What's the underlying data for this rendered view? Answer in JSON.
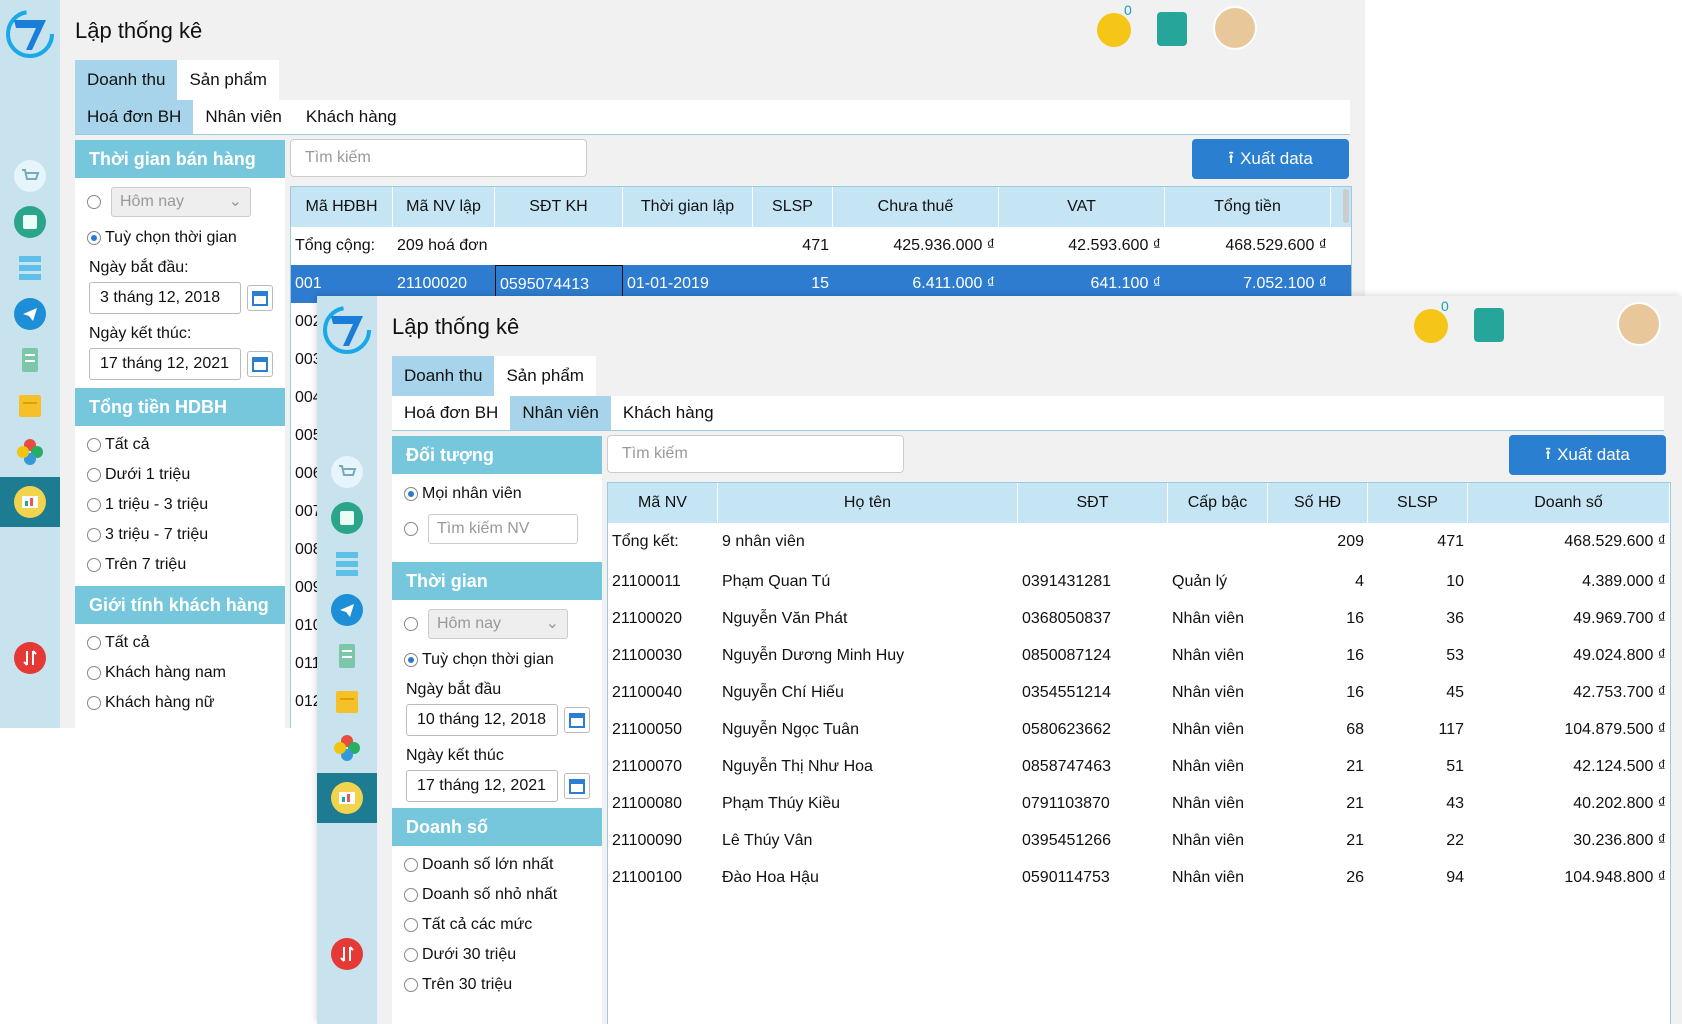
{
  "win1": {
    "title": "Lập thống kê",
    "badge_count": "0",
    "main_tabs": [
      "Doanh thu",
      "Sản phẩm"
    ],
    "sub_tabs": [
      "Hoá đơn BH",
      "Nhân viên",
      "Khách hàng"
    ],
    "sections": {
      "time": "Thời gian bán hàng",
      "total": "Tổng tiền HDBH",
      "gender": "Giới tính khách hàng"
    },
    "time_combo": "Hôm nay",
    "custom_time": "Tuỳ chọn thời gian",
    "start_label": "Ngày bắt đầu:",
    "start_value": "3 tháng 12, 2018",
    "end_label": "Ngày kết thúc:",
    "end_value": "17 tháng 12, 2021",
    "total_options": [
      "Tất cả",
      "Dưới 1 triệu",
      "1 triệu - 3 triệu",
      "3 triệu - 7 triệu",
      "Trên 7 triệu"
    ],
    "gender_options": [
      "Tất cả",
      "Khách hàng nam",
      "Khách hàng nữ"
    ],
    "search_placeholder": "Tìm kiếm",
    "export_label": "Xuất data",
    "columns": [
      "Mã HĐBH",
      "Mã NV lập",
      "SĐT KH",
      "Thời gian lập",
      "SLSP",
      "Chưa thuế",
      "VAT",
      "Tổng tiền"
    ],
    "summary": {
      "label": "Tổng cộng:",
      "count": "209 hoá đơn",
      "slsp": "471",
      "pretax": "425.936.000 ₫",
      "vat": "42.593.600 ₫",
      "total": "468.529.600 ₫"
    },
    "selected_row": {
      "id": "001",
      "staff": "21100020",
      "phone": "0595074413",
      "date": "01-01-2019",
      "slsp": "15",
      "pretax": "6.411.000 ₫",
      "vat": "641.100 ₫",
      "total": "7.052.100 ₫"
    },
    "row_ids": [
      "002",
      "003",
      "004",
      "005",
      "006",
      "007",
      "008",
      "009",
      "010",
      "011",
      "012"
    ]
  },
  "win2": {
    "title": "Lập thống kê",
    "badge_count": "0",
    "main_tabs": [
      "Doanh thu",
      "Sản phẩm"
    ],
    "sub_tabs": [
      "Hoá đơn BH",
      "Nhân viên",
      "Khách hàng"
    ],
    "sections": {
      "target": "Đối tượng",
      "time": "Thời gian",
      "revenue": "Doanh số"
    },
    "all_staff": "Mọi nhân viên",
    "staff_search_placeholder": "Tìm kiếm NV",
    "time_combo": "Hôm nay",
    "custom_time": "Tuỳ chọn thời gian",
    "start_label": "Ngày bắt đầu",
    "start_value": "10 tháng 12, 2018",
    "end_label": "Ngày kết thúc",
    "end_value": "17 tháng 12, 2021",
    "revenue_options": [
      "Doanh số lớn nhất",
      "Doanh số nhỏ nhất",
      "Tất cả các mức",
      "Dưới 30 triệu",
      "Trên 30 triệu"
    ],
    "search_placeholder": "Tìm kiếm",
    "export_label": "Xuất data",
    "columns": [
      "Mã NV",
      "Họ tên",
      "SĐT",
      "Cấp bậc",
      "Số HĐ",
      "SLSP",
      "Doanh số"
    ],
    "summary": {
      "label": "Tổng kết:",
      "count": "9 nhân viên",
      "invoices": "209",
      "slsp": "471",
      "revenue": "468.529.600 ₫"
    },
    "rows": [
      {
        "id": "21100011",
        "name": "Phạm Quan Tú",
        "phone": "0391431281",
        "rank": "Quản lý",
        "invoices": "4",
        "slsp": "10",
        "revenue": "4.389.000 ₫"
      },
      {
        "id": "21100020",
        "name": "Nguyễn Văn Phát",
        "phone": "0368050837",
        "rank": "Nhân viên",
        "invoices": "16",
        "slsp": "36",
        "revenue": "49.969.700 ₫"
      },
      {
        "id": "21100030",
        "name": "Nguyễn Dương Minh Huy",
        "phone": "0850087124",
        "rank": "Nhân viên",
        "invoices": "16",
        "slsp": "53",
        "revenue": "49.024.800 ₫"
      },
      {
        "id": "21100040",
        "name": "Nguyễn Chí Hiếu",
        "phone": "0354551214",
        "rank": "Nhân viên",
        "invoices": "16",
        "slsp": "45",
        "revenue": "42.753.700 ₫"
      },
      {
        "id": "21100050",
        "name": "Nguyễn Ngọc Tuân",
        "phone": "0580623662",
        "rank": "Nhân viên",
        "invoices": "68",
        "slsp": "117",
        "revenue": "104.879.500 ₫"
      },
      {
        "id": "21100070",
        "name": "Nguyễn Thị Như Hoa",
        "phone": "0858747463",
        "rank": "Nhân viên",
        "invoices": "21",
        "slsp": "51",
        "revenue": "42.124.500 ₫"
      },
      {
        "id": "21100080",
        "name": "Phạm Thúy Kiều",
        "phone": "0791103870",
        "rank": "Nhân viên",
        "invoices": "21",
        "slsp": "43",
        "revenue": "40.202.800 ₫"
      },
      {
        "id": "21100090",
        "name": "Lê Thúy Vân",
        "phone": "0395451266",
        "rank": "Nhân viên",
        "invoices": "21",
        "slsp": "22",
        "revenue": "30.236.800 ₫"
      },
      {
        "id": "21100100",
        "name": "Đào Hoa Hậu",
        "phone": "0590114753",
        "rank": "Nhân viên",
        "invoices": "26",
        "slsp": "94",
        "revenue": "104.948.800 ₫"
      }
    ]
  },
  "rail_icons": [
    "cart-icon",
    "dashboard-icon",
    "server-icon",
    "telegram-icon",
    "receipt-icon",
    "notes-icon",
    "flower-icon",
    "statistics-icon"
  ],
  "colors": {
    "accent": "#2a7fd0",
    "section": "#76c6dc",
    "rail": "#c8e2ee",
    "rail_active": "#1e7c92",
    "header": "#c5e5f5"
  }
}
